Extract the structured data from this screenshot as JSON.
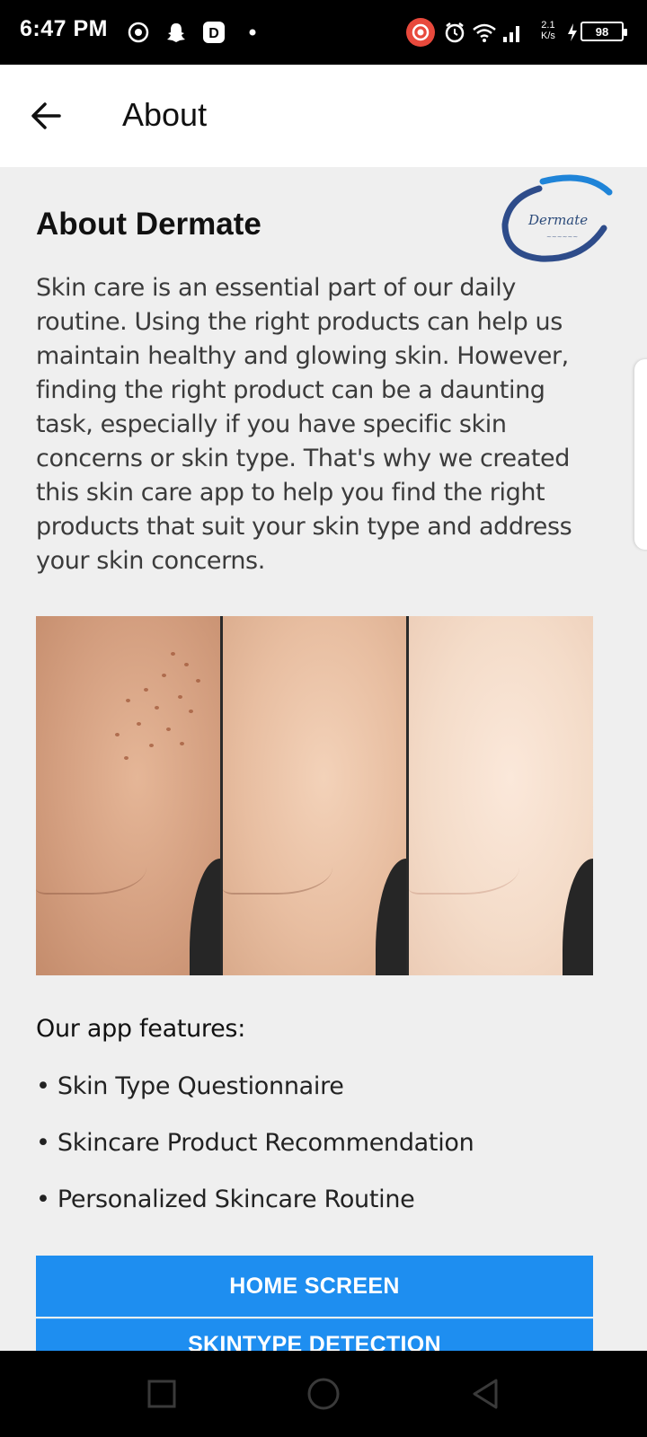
{
  "status_bar": {
    "time": "6:47 PM",
    "battery": "98",
    "network_top": "2.1",
    "network_bottom": "K/s",
    "icons": [
      "camera-notification-icon",
      "snapchat-icon",
      "app-notification-icon",
      "dot-icon",
      "screen-record-icon",
      "alarm-icon",
      "wifi-icon",
      "signal-icon",
      "battery-icon"
    ]
  },
  "app_bar": {
    "title": "About",
    "back_icon": "back-arrow-icon"
  },
  "content": {
    "heading": "About Dermate",
    "logo_text": "Dermate",
    "description": "Skin care is an essential part of our daily routine. Using the right products can help us maintain healthy and glowing skin. However, finding the right product can be a daunting task, especially if you have specific skin concerns or skin type. That's why we created this skin care app to help you find the right products that suit your skin type and address your skin concerns.",
    "features_title": "Our app features:",
    "features": [
      "• Skin Type Questionnaire",
      "• Skincare Product Recommendation",
      "• Personalized Skincare Routine"
    ]
  },
  "buttons": {
    "home": "HOME SCREEN",
    "skintype": "SKINTYPE DETECTION"
  },
  "colors": {
    "accent": "#1e8ef0",
    "background": "#efefef",
    "status_bar": "#000000",
    "app_bar": "#ffffff",
    "record_icon": "#e8493c"
  },
  "nav_bar": {
    "icons": [
      "recents-square-icon",
      "home-circle-icon",
      "back-triangle-icon"
    ]
  }
}
